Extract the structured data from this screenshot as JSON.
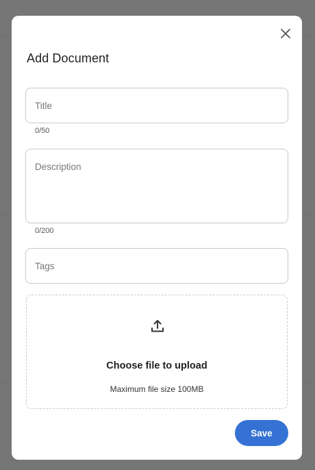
{
  "dialog": {
    "title": "Add Document",
    "close_icon": "close-icon"
  },
  "form": {
    "title_field": {
      "placeholder": "Title",
      "value": "",
      "counter": "0/50"
    },
    "description_field": {
      "placeholder": "Description",
      "value": "",
      "counter": "0/200"
    },
    "tags_field": {
      "placeholder": "Tags",
      "value": ""
    }
  },
  "upload": {
    "icon": "upload-icon",
    "label": "Choose file to upload",
    "hint": "Maximum file size 100MB"
  },
  "actions": {
    "save_label": "Save"
  },
  "colors": {
    "accent": "#3572d4",
    "backdrop": "#767676"
  }
}
